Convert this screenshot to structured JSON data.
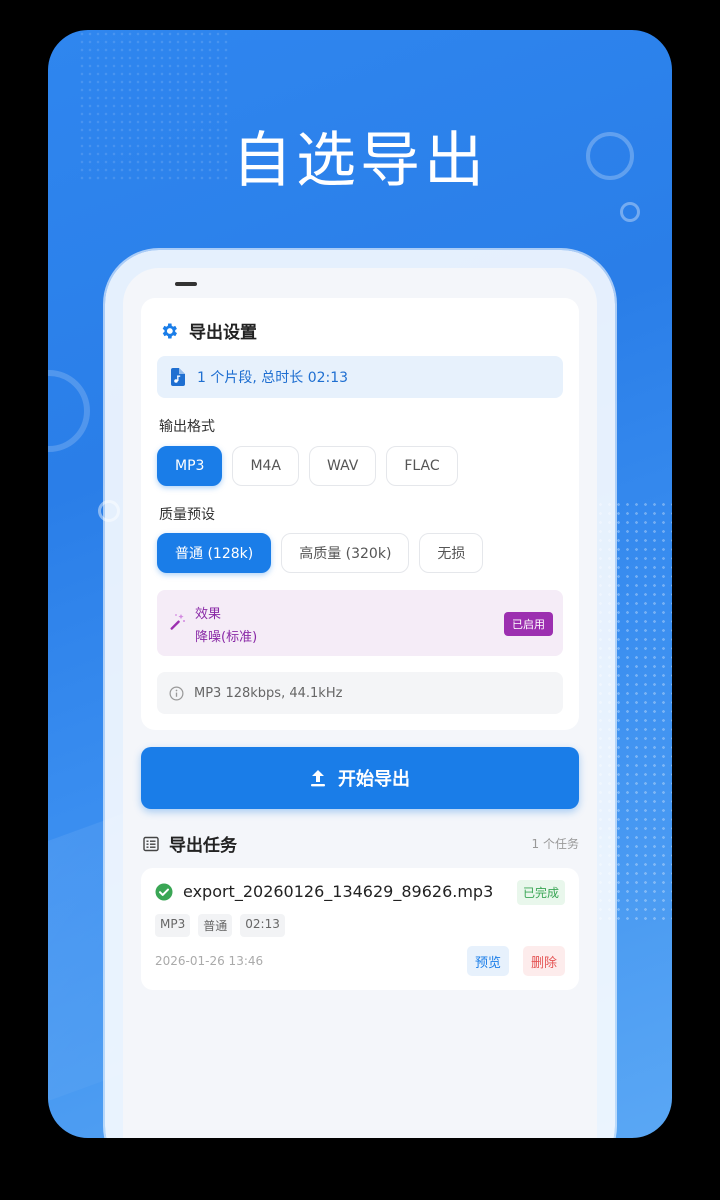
{
  "hero": {
    "title": "自选导出"
  },
  "settings": {
    "title": "导出设置",
    "icon": "gear-icon",
    "clip_info": "1 个片段, 总时长 02:13",
    "format_label": "输出格式",
    "formats": [
      "MP3",
      "M4A",
      "WAV",
      "FLAC"
    ],
    "format_selected": "MP3",
    "quality_label": "质量预设",
    "qualities": [
      "普通 (128k)",
      "高质量 (320k)",
      "无损"
    ],
    "quality_selected": "普通 (128k)",
    "effect": {
      "title": "效果",
      "value": "降噪(标准)",
      "badge": "已启用",
      "icon": "magic-wand-icon"
    },
    "summary": "MP3 128kbps, 44.1kHz"
  },
  "export_button": {
    "label": "开始导出",
    "icon": "upload-icon"
  },
  "tasks": {
    "title": "导出任务",
    "count": "1 个任务",
    "items": [
      {
        "filename": "export_20260126_134629_89626.mp3",
        "status": "已完成",
        "tags": [
          "MP3",
          "普通",
          "02:13"
        ],
        "time": "2026-01-26 13:46",
        "preview_label": "预览",
        "delete_label": "删除"
      }
    ]
  },
  "colors": {
    "accent": "#1a7de8",
    "effect_text": "#8a2aa7",
    "success": "#3aa655",
    "danger": "#e45454"
  }
}
